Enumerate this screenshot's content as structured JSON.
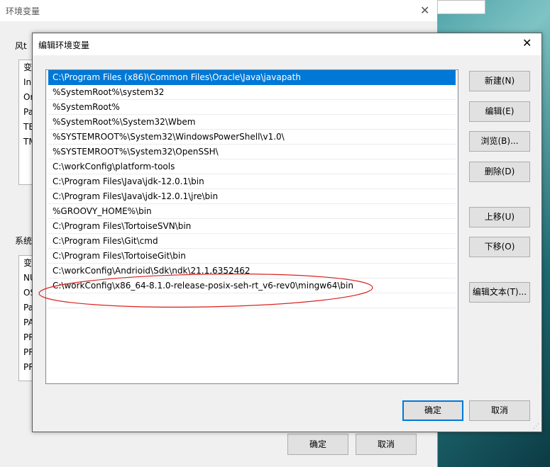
{
  "background_dialog": {
    "title": "环境变量",
    "user_section_label": "风t",
    "user_rows": [
      "变",
      "In",
      "Or",
      "Pa",
      "TE",
      "TM"
    ],
    "system_section_label": "系统",
    "system_rows": [
      "变",
      "NU",
      "OS",
      "Pa",
      "PA",
      "PR",
      "PR",
      "PR"
    ],
    "ok_label": "确定",
    "cancel_label": "取消"
  },
  "edit_dialog": {
    "title": "编辑环境变量",
    "close_glyph": "✕",
    "paths": [
      "C:\\Program Files (x86)\\Common Files\\Oracle\\Java\\javapath",
      "%SystemRoot%\\system32",
      "%SystemRoot%",
      "%SystemRoot%\\System32\\Wbem",
      "%SYSTEMROOT%\\System32\\WindowsPowerShell\\v1.0\\",
      "%SYSTEMROOT%\\System32\\OpenSSH\\",
      "C:\\workConfig\\platform-tools",
      "C:\\Program Files\\Java\\jdk-12.0.1\\bin",
      "C:\\Program Files\\Java\\jdk-12.0.1\\jre\\bin",
      "%GROOVY_HOME%\\bin",
      "C:\\Program Files\\TortoiseSVN\\bin",
      "C:\\Program Files\\Git\\cmd",
      "C:\\Program Files\\TortoiseGit\\bin",
      "C:\\workConfig\\Andrioid\\Sdk\\ndk\\21.1.6352462",
      "C:\\workConfig\\x86_64-8.1.0-release-posix-seh-rt_v6-rev0\\mingw64\\bin"
    ],
    "selected_index": 0,
    "buttons": {
      "new": "新建(N)",
      "edit": "编辑(E)",
      "browse": "浏览(B)...",
      "delete": "删除(D)",
      "move_up": "上移(U)",
      "move_down": "下移(O)",
      "edit_text": "编辑文本(T)..."
    },
    "ok_label": "确定",
    "cancel_label": "取消"
  },
  "colors": {
    "selection": "#0078d7",
    "annotation": "#d9231f"
  }
}
